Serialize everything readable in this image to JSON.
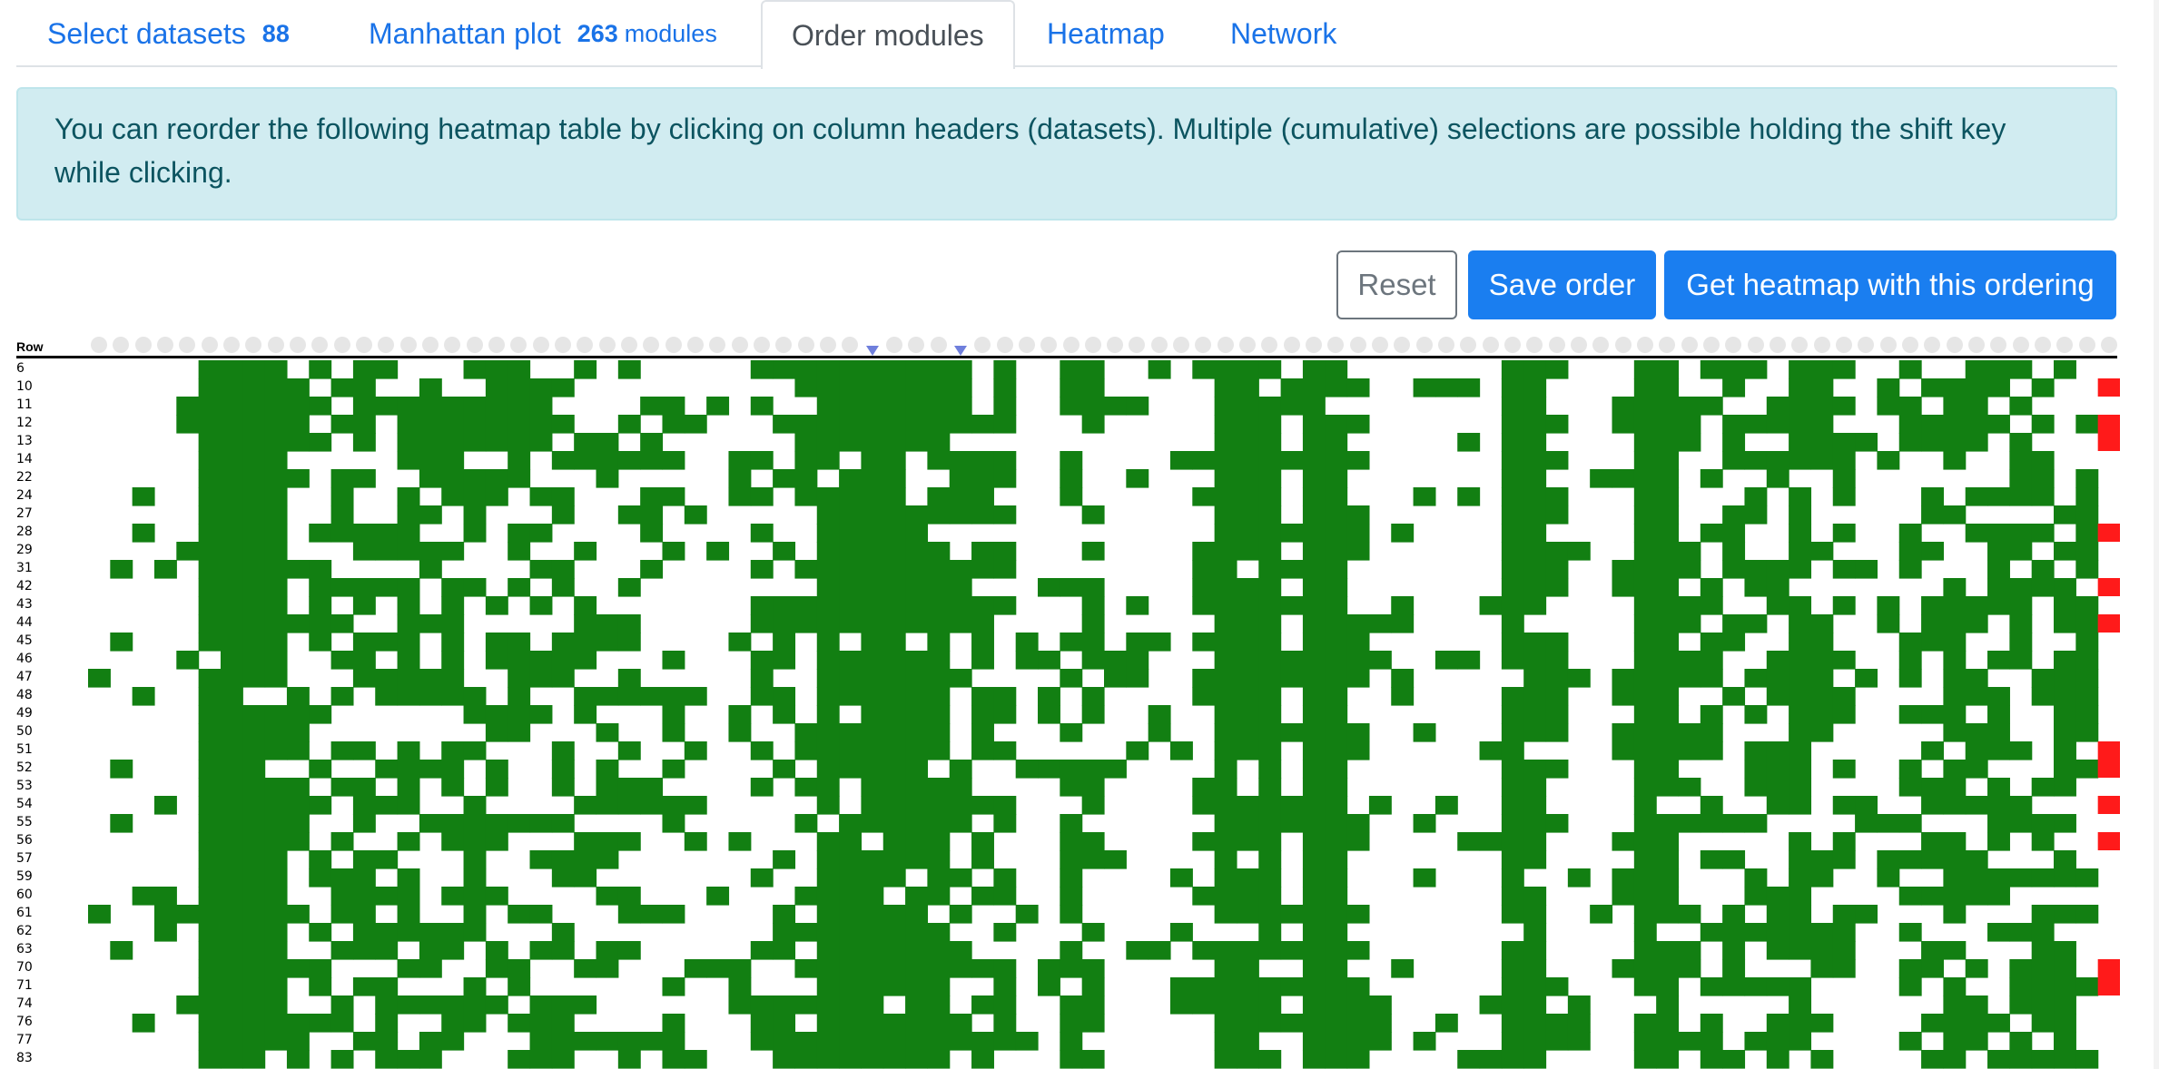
{
  "tabs": [
    {
      "label": "Select datasets",
      "count": "88",
      "suffix": ""
    },
    {
      "label": "Manhattan plot",
      "count": "263",
      "suffix": "modules"
    },
    {
      "label": "Order modules",
      "count": "",
      "suffix": ""
    },
    {
      "label": "Heatmap",
      "count": "",
      "suffix": ""
    },
    {
      "label": "Network",
      "count": "",
      "suffix": ""
    }
  ],
  "alert": {
    "text": "You can reorder the following heatmap table by clicking on column headers (datasets). Multiple (cumulative) selections are possible holding the shift key while clicking."
  },
  "buttons": {
    "reset": "Reset",
    "save": "Save order",
    "get": "Get heatmap with this ordering"
  },
  "heatmap": {
    "row_header": "Row",
    "rows": [
      "6",
      "10",
      "11",
      "12",
      "13",
      "14",
      "22",
      "24",
      "27",
      "28",
      "29",
      "31",
      "42",
      "43",
      "44",
      "45",
      "46",
      "47",
      "48",
      "49",
      "50",
      "51",
      "52",
      "53",
      "54",
      "55",
      "56",
      "57",
      "59",
      "60",
      "61",
      "62",
      "63",
      "70",
      "71",
      "74",
      "76",
      "77",
      "83"
    ],
    "column_count": 92,
    "colors": {
      "present": "#127f12",
      "flag": "#ff1a1a",
      "empty": "#ffffff"
    }
  }
}
